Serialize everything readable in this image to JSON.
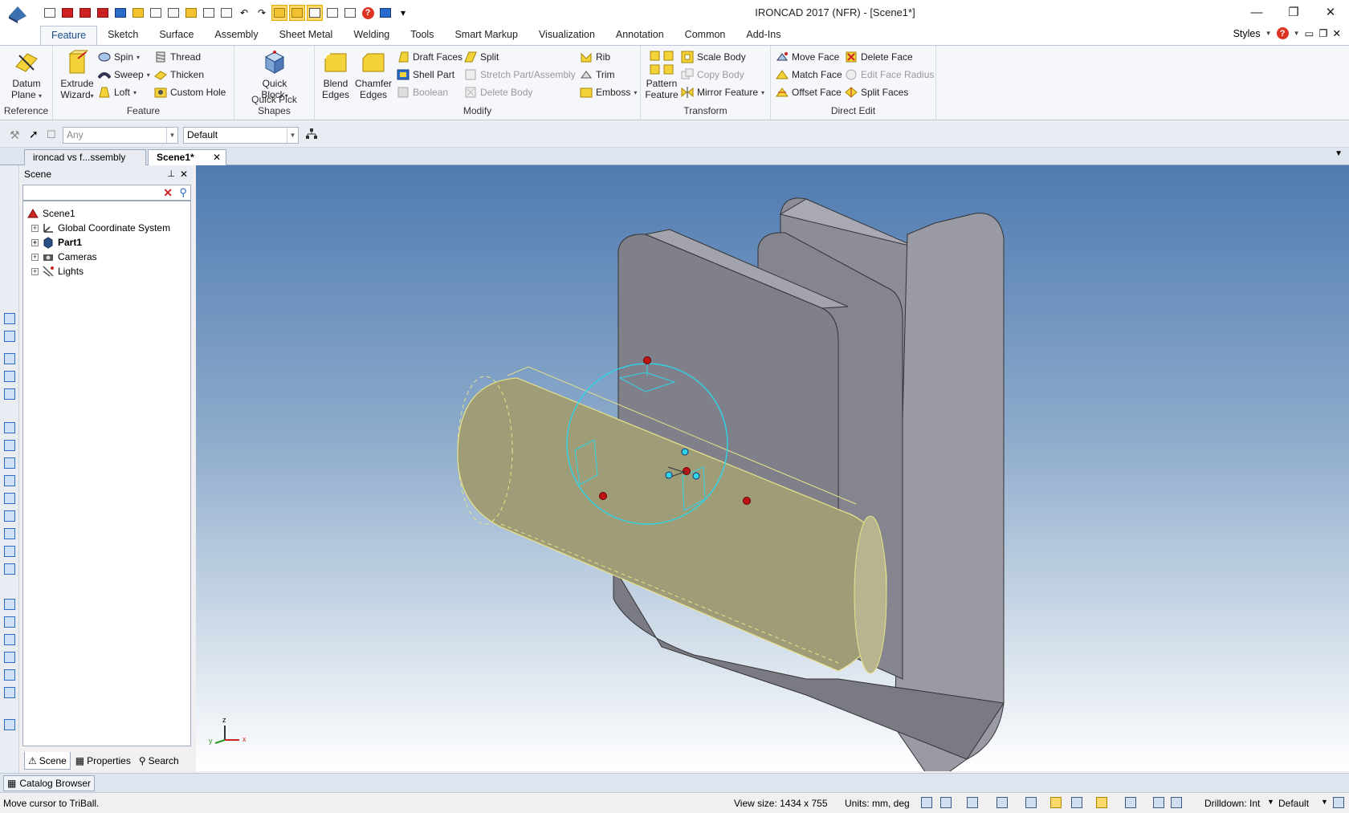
{
  "window": {
    "title": "IRONCAD 2017 (NFR) - [Scene1*]",
    "minimize_icon": "minimize-icon",
    "restore_icon": "restore-icon",
    "close_icon": "close-icon"
  },
  "quick_access": {
    "more_label": "▾"
  },
  "ribbon_tabs": [
    "Feature",
    "Sketch",
    "Surface",
    "Assembly",
    "Sheet Metal",
    "Welding",
    "Tools",
    "Smart Markup",
    "Visualization",
    "Annotation",
    "Common",
    "Add-Ins"
  ],
  "ribbon_right": {
    "styles_label": "Styles",
    "help_label": "?"
  },
  "ribbon": {
    "reference": {
      "label": "Reference",
      "datum_plane": [
        "Datum",
        "Plane"
      ]
    },
    "feature": {
      "label": "Feature",
      "extrude": [
        "Extrude",
        "Wizard"
      ],
      "spin": "Spin",
      "sweep": "Sweep",
      "loft": "Loft",
      "thread": "Thread",
      "thicken": "Thicken",
      "custom_hole": "Custom Hole"
    },
    "quick_pick": {
      "label": "Quick Pick Shapes",
      "quick_block": [
        "Quick",
        "Block"
      ]
    },
    "modify": {
      "label": "Modify",
      "blend": [
        "Blend",
        "Edges"
      ],
      "chamfer": [
        "Chamfer",
        "Edges"
      ],
      "draft_faces": "Draft Faces",
      "shell_part": "Shell Part",
      "boolean": "Boolean",
      "split": "Split",
      "stretch": "Stretch Part/Assembly",
      "delete_body": "Delete Body",
      "rib": "Rib",
      "trim": "Trim",
      "emboss": "Emboss"
    },
    "transform": {
      "label": "Transform",
      "pattern": [
        "Pattern",
        "Feature"
      ],
      "scale_body": "Scale Body",
      "copy_body": "Copy Body",
      "mirror_feature": "Mirror Feature"
    },
    "direct_edit": {
      "label": "Direct Edit",
      "move_face": "Move Face",
      "match_face": "Match Face",
      "offset_face": "Offset Face",
      "delete_face": "Delete Face",
      "edit_face_radius": "Edit Face Radius",
      "split_faces": "Split Faces"
    }
  },
  "selection_toolbar": {
    "filter_value": "Any",
    "style_value": "Default"
  },
  "doc_tabs": [
    {
      "label": "ironcad vs f...ssembly"
    },
    {
      "label": "Scene1*"
    }
  ],
  "scene_panel": {
    "title": "Scene",
    "tree": [
      {
        "label": "Scene1"
      },
      {
        "label": "Global Coordinate System"
      },
      {
        "label": "Part1"
      },
      {
        "label": "Cameras"
      },
      {
        "label": "Lights"
      }
    ],
    "tabs": [
      "Scene",
      "Properties",
      "Search"
    ]
  },
  "triad": {
    "x": "x",
    "y": "y",
    "z": "z"
  },
  "catalog": {
    "label": "Catalog Browser"
  },
  "status": {
    "message": "Move cursor to TriBall.",
    "view_size": "View size: 1434 x  755",
    "units": "Units: mm, deg",
    "drilldown": "Drilldown: Int",
    "style": "Default"
  },
  "colors": {
    "accent": "#1a4e8c",
    "part_gray": "#8a8a94",
    "selected_yellow": "#b9b58a",
    "triball_cyan": "#2fd4e6"
  }
}
